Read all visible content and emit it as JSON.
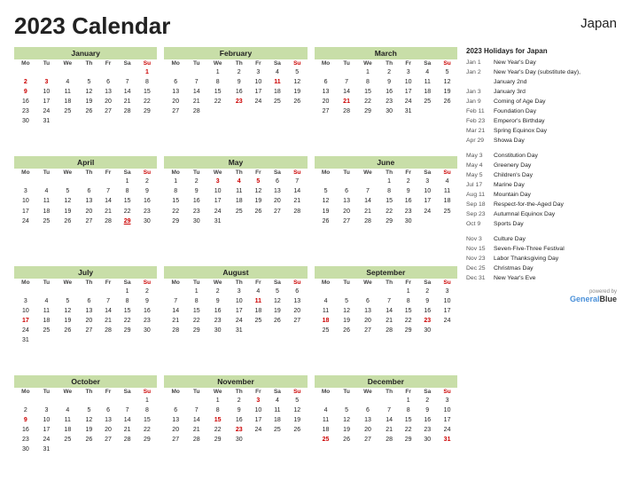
{
  "title": "2023 Calendar",
  "country": "Japan",
  "holidays_title": "2023 Holidays for Japan",
  "holidays": [
    {
      "date": "Jan 1",
      "name": "New Year's Day"
    },
    {
      "date": "Jan 2",
      "name": "New Year's Day (substitute day),"
    },
    {
      "date": "",
      "name": "January 2nd"
    },
    {
      "date": "Jan 3",
      "name": "January 3rd"
    },
    {
      "date": "Jan 9",
      "name": "Coming of Age Day"
    },
    {
      "date": "Feb 11",
      "name": "Foundation Day"
    },
    {
      "date": "Feb 23",
      "name": "Emperor's Birthday"
    },
    {
      "date": "Mar 21",
      "name": "Spring Equinox Day"
    },
    {
      "date": "Apr 29",
      "name": "Showa Day"
    },
    {
      "date": "May 3",
      "name": "Constitution Day"
    },
    {
      "date": "May 4",
      "name": "Greenery Day"
    },
    {
      "date": "May 5",
      "name": "Children's Day"
    },
    {
      "date": "Jul 17",
      "name": "Marine Day"
    },
    {
      "date": "Aug 11",
      "name": "Mountain Day"
    },
    {
      "date": "Sep 18",
      "name": "Respect-for-the-Aged Day"
    },
    {
      "date": "Sep 23",
      "name": "Autumnal Equinox Day"
    },
    {
      "date": "Oct 9",
      "name": "Sports Day"
    },
    {
      "date": "Nov 3",
      "name": "Culture Day"
    },
    {
      "date": "Nov 15",
      "name": "Seven-Five-Three Festival"
    },
    {
      "date": "Nov 23",
      "name": "Labor Thanksgiving Day"
    },
    {
      "date": "Dec 25",
      "name": "Christmas Day"
    },
    {
      "date": "Dec 31",
      "name": "New Year's Eve"
    }
  ],
  "powered_by": "powered by",
  "brand": "GeneralBlue"
}
